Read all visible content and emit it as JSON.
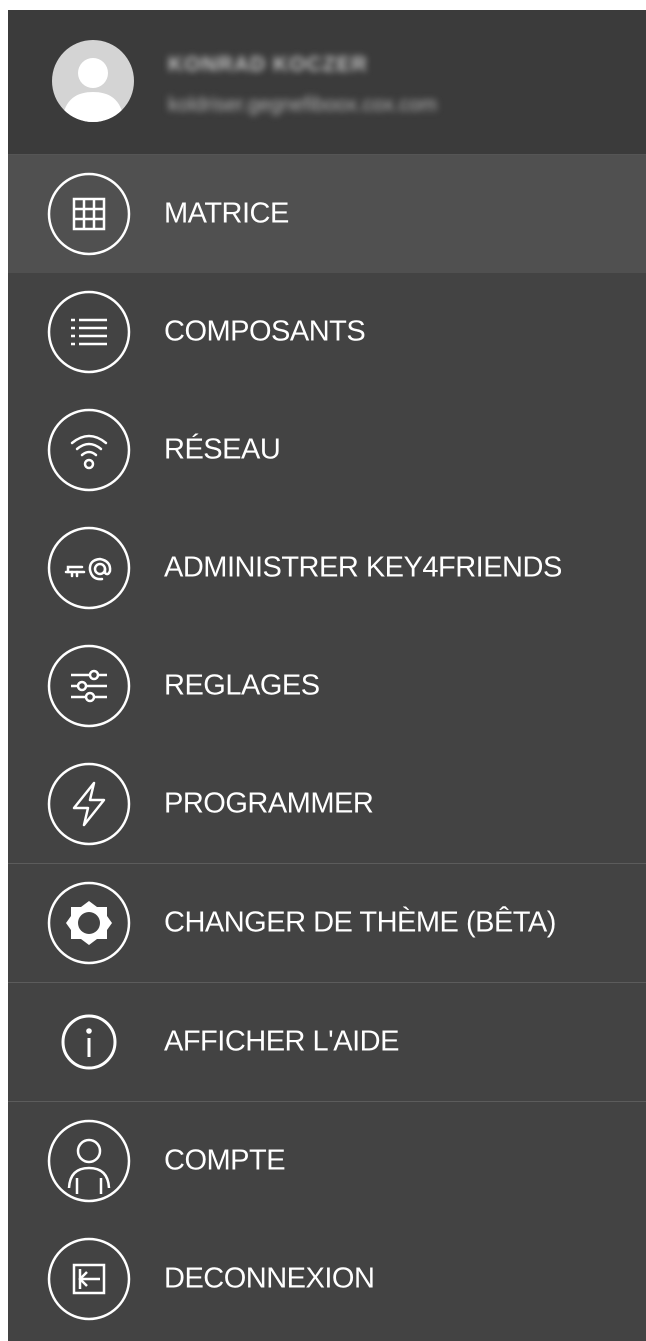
{
  "profile": {
    "name": "KONRAD KOCZER",
    "email": "koldriser.gegnefiboox.cox.com"
  },
  "menu": {
    "items": [
      {
        "label": "MATRICE"
      },
      {
        "label": "COMPOSANTS"
      },
      {
        "label": "RÉSEAU"
      },
      {
        "label": "ADMINISTRER KEY4FRIENDS"
      },
      {
        "label": "REGLAGES"
      },
      {
        "label": "PROGRAMMER"
      },
      {
        "label": "CHANGER DE THÈME (BÊTA)"
      },
      {
        "label": "AFFICHER L'AIDE"
      },
      {
        "label": "COMPTE"
      },
      {
        "label": "DECONNEXION"
      }
    ],
    "active_index": 0
  },
  "colors": {
    "drawer_bg": "#434343",
    "profile_bg": "#3b3b3b",
    "active_bg": "#505050",
    "text": "#ffffff"
  },
  "icons": [
    "grid-icon",
    "list-icon",
    "wifi-icon",
    "key-at-icon",
    "sliders-icon",
    "lightning-icon",
    "theme-sun-icon",
    "info-icon",
    "user-icon",
    "logout-icon"
  ]
}
